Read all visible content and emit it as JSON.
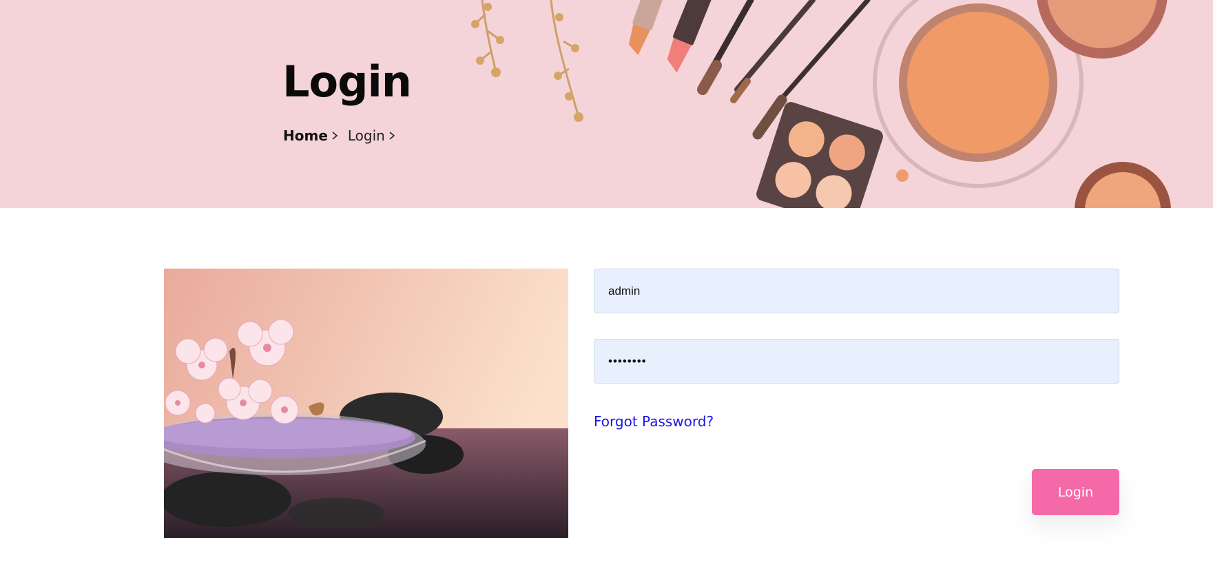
{
  "header": {
    "title": "Login",
    "breadcrumb": {
      "home": "Home",
      "current": "Login"
    }
  },
  "form": {
    "username": {
      "value": "admin",
      "placeholder": ""
    },
    "password": {
      "value": "••••••••",
      "placeholder": ""
    },
    "forgot_label": "Forgot Password?",
    "submit_label": "Login"
  },
  "colors": {
    "banner": "#f4d4d9",
    "accent": "#f46aa8",
    "link": "#1a16e6",
    "input_bg": "#e8effd"
  },
  "icons": {
    "breadcrumb_separator": "chevron-right-icon"
  }
}
